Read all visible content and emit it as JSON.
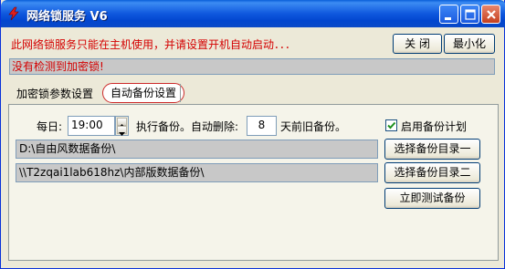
{
  "window": {
    "title": "网络锁服务  V6"
  },
  "header": {
    "warning": "此网络锁服务只能在主机使用，并请设置开机自动启动．．．",
    "close_label": "关 闭",
    "minimize_label": "最小化"
  },
  "status": {
    "text": "没有检测到加密锁!"
  },
  "tabs": [
    {
      "label": "加密锁参数设置",
      "active": false
    },
    {
      "label": "自动备份设置",
      "active": true
    }
  ],
  "backup": {
    "daily_label": "每日:",
    "time_value": "19:00",
    "execute_label": "执行备份。自动删除:",
    "days_value": "8",
    "days_suffix": "天前旧备份。",
    "enable_label": "启用备份计划",
    "enable_checked": true,
    "dir1_value": "D:\\自由风数据备份\\",
    "dir1_button": "选择备份目录一",
    "dir2_value": "\\\\T2zqai1lab618hz\\内部版数据备份\\",
    "dir2_button": "选择备份目录二",
    "test_button": "立即测试备份"
  },
  "colors": {
    "warning": "#d40000",
    "titlebar": "#0a49c7"
  },
  "icons": {
    "app": "red-lightning-icon",
    "minimize": "minimize-icon",
    "maximize": "maximize-icon",
    "close": "close-icon",
    "check": "check-icon"
  }
}
